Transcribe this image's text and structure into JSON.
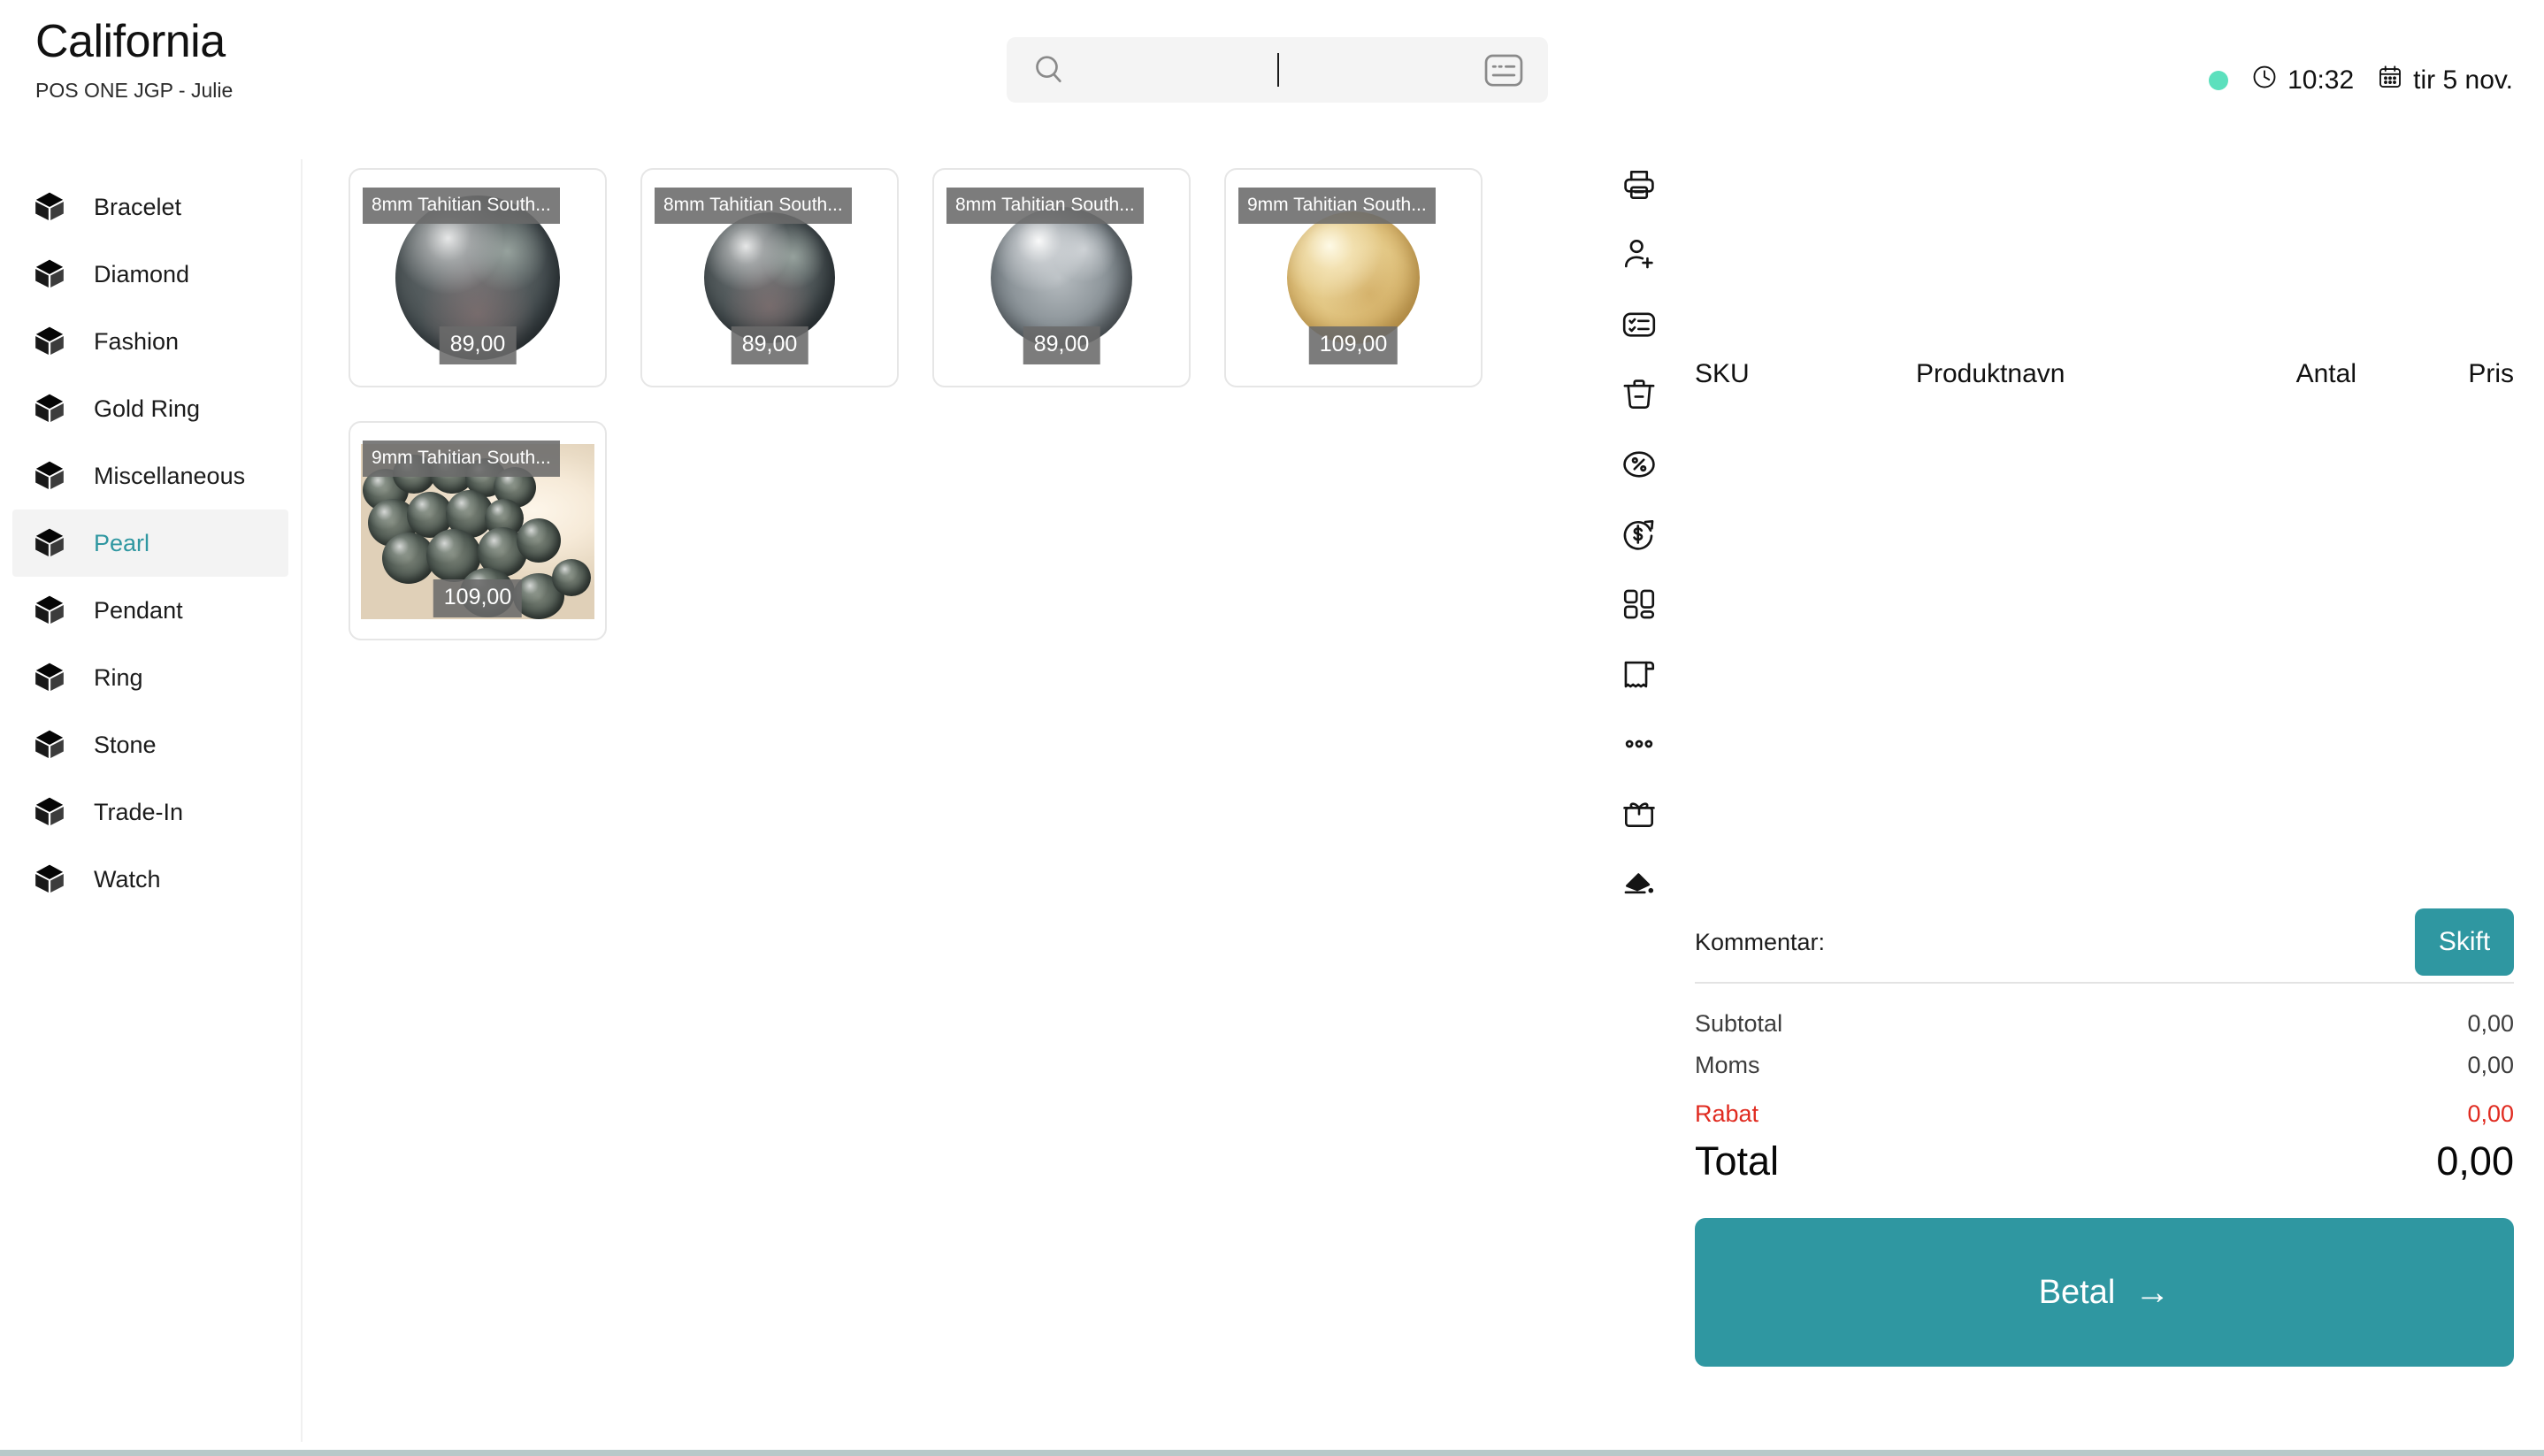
{
  "header": {
    "store_name": "California",
    "terminal_user": "POS ONE JGP - Julie"
  },
  "search": {
    "value": "",
    "placeholder": "",
    "search_icon": "search-icon",
    "numpad_icon": "numpad-icon"
  },
  "status": {
    "connection_indicator": "online-dot",
    "clock_icon": "clock-icon",
    "time": "10:32",
    "calendar_icon": "calendar-icon",
    "date": "tir 5 nov."
  },
  "sidebar": {
    "items": [
      {
        "label": "Bracelet",
        "icon": "cube-icon",
        "active": false
      },
      {
        "label": "Diamond",
        "icon": "cube-icon",
        "active": false
      },
      {
        "label": "Fashion",
        "icon": "cube-icon",
        "active": false
      },
      {
        "label": "Gold Ring",
        "icon": "cube-icon",
        "active": false
      },
      {
        "label": "Miscellaneous",
        "icon": "cube-icon",
        "active": false
      },
      {
        "label": "Pearl",
        "icon": "cube-icon",
        "active": true
      },
      {
        "label": "Pendant",
        "icon": "cube-icon",
        "active": false
      },
      {
        "label": "Ring",
        "icon": "cube-icon",
        "active": false
      },
      {
        "label": "Stone",
        "icon": "cube-icon",
        "active": false
      },
      {
        "label": "Trade-In",
        "icon": "cube-icon",
        "active": false
      },
      {
        "label": "Watch",
        "icon": "cube-icon",
        "active": false
      }
    ]
  },
  "products": [
    {
      "name": "8mm Tahitian South...",
      "price": "89,00"
    },
    {
      "name": "8mm Tahitian South...",
      "price": "89,00"
    },
    {
      "name": "8mm Tahitian South...",
      "price": "89,00"
    },
    {
      "name": "9mm Tahitian South...",
      "price": "109,00"
    },
    {
      "name": "9mm Tahitian South...",
      "price": "109,00"
    }
  ],
  "toolbar": {
    "items": [
      {
        "icon": "printer-icon",
        "name": "print-receipt"
      },
      {
        "icon": "add-customer-icon",
        "name": "add-customer"
      },
      {
        "icon": "checklist-icon",
        "name": "order-list"
      },
      {
        "icon": "trash-icon",
        "name": "delete-order"
      },
      {
        "icon": "percent-icon",
        "name": "discount"
      },
      {
        "icon": "refund-icon",
        "name": "refund"
      },
      {
        "icon": "grid-icon",
        "name": "dashboard"
      },
      {
        "icon": "receipt-icon",
        "name": "receipts"
      },
      {
        "icon": "ellipsis-icon",
        "name": "more-options"
      },
      {
        "icon": "gift-icon",
        "name": "gift-card"
      },
      {
        "icon": "fill-icon",
        "name": "theme"
      }
    ]
  },
  "receipt": {
    "columns": {
      "sku": "SKU",
      "product_name": "Produktnavn",
      "quantity": "Antal",
      "price": "Pris"
    },
    "lines": [],
    "comment_label": "Kommentar:",
    "comment_button": "Skift",
    "totals": [
      {
        "label": "Subtotal",
        "value": "0,00"
      },
      {
        "label": "Moms",
        "value": "0,00"
      },
      {
        "label": "Rabat",
        "value": "0,00"
      }
    ],
    "grand_total_label": "Total",
    "grand_total_value": "0,00",
    "pay_button": "Betal",
    "pay_arrow": "→"
  },
  "colors": {
    "accent_teal": "#2f97a1",
    "online_dot": "#5ce0bd",
    "discount_red": "#e02b20",
    "overlay_gray": "#6a6a6a",
    "active_nav_bg": "#f3f3f3"
  }
}
